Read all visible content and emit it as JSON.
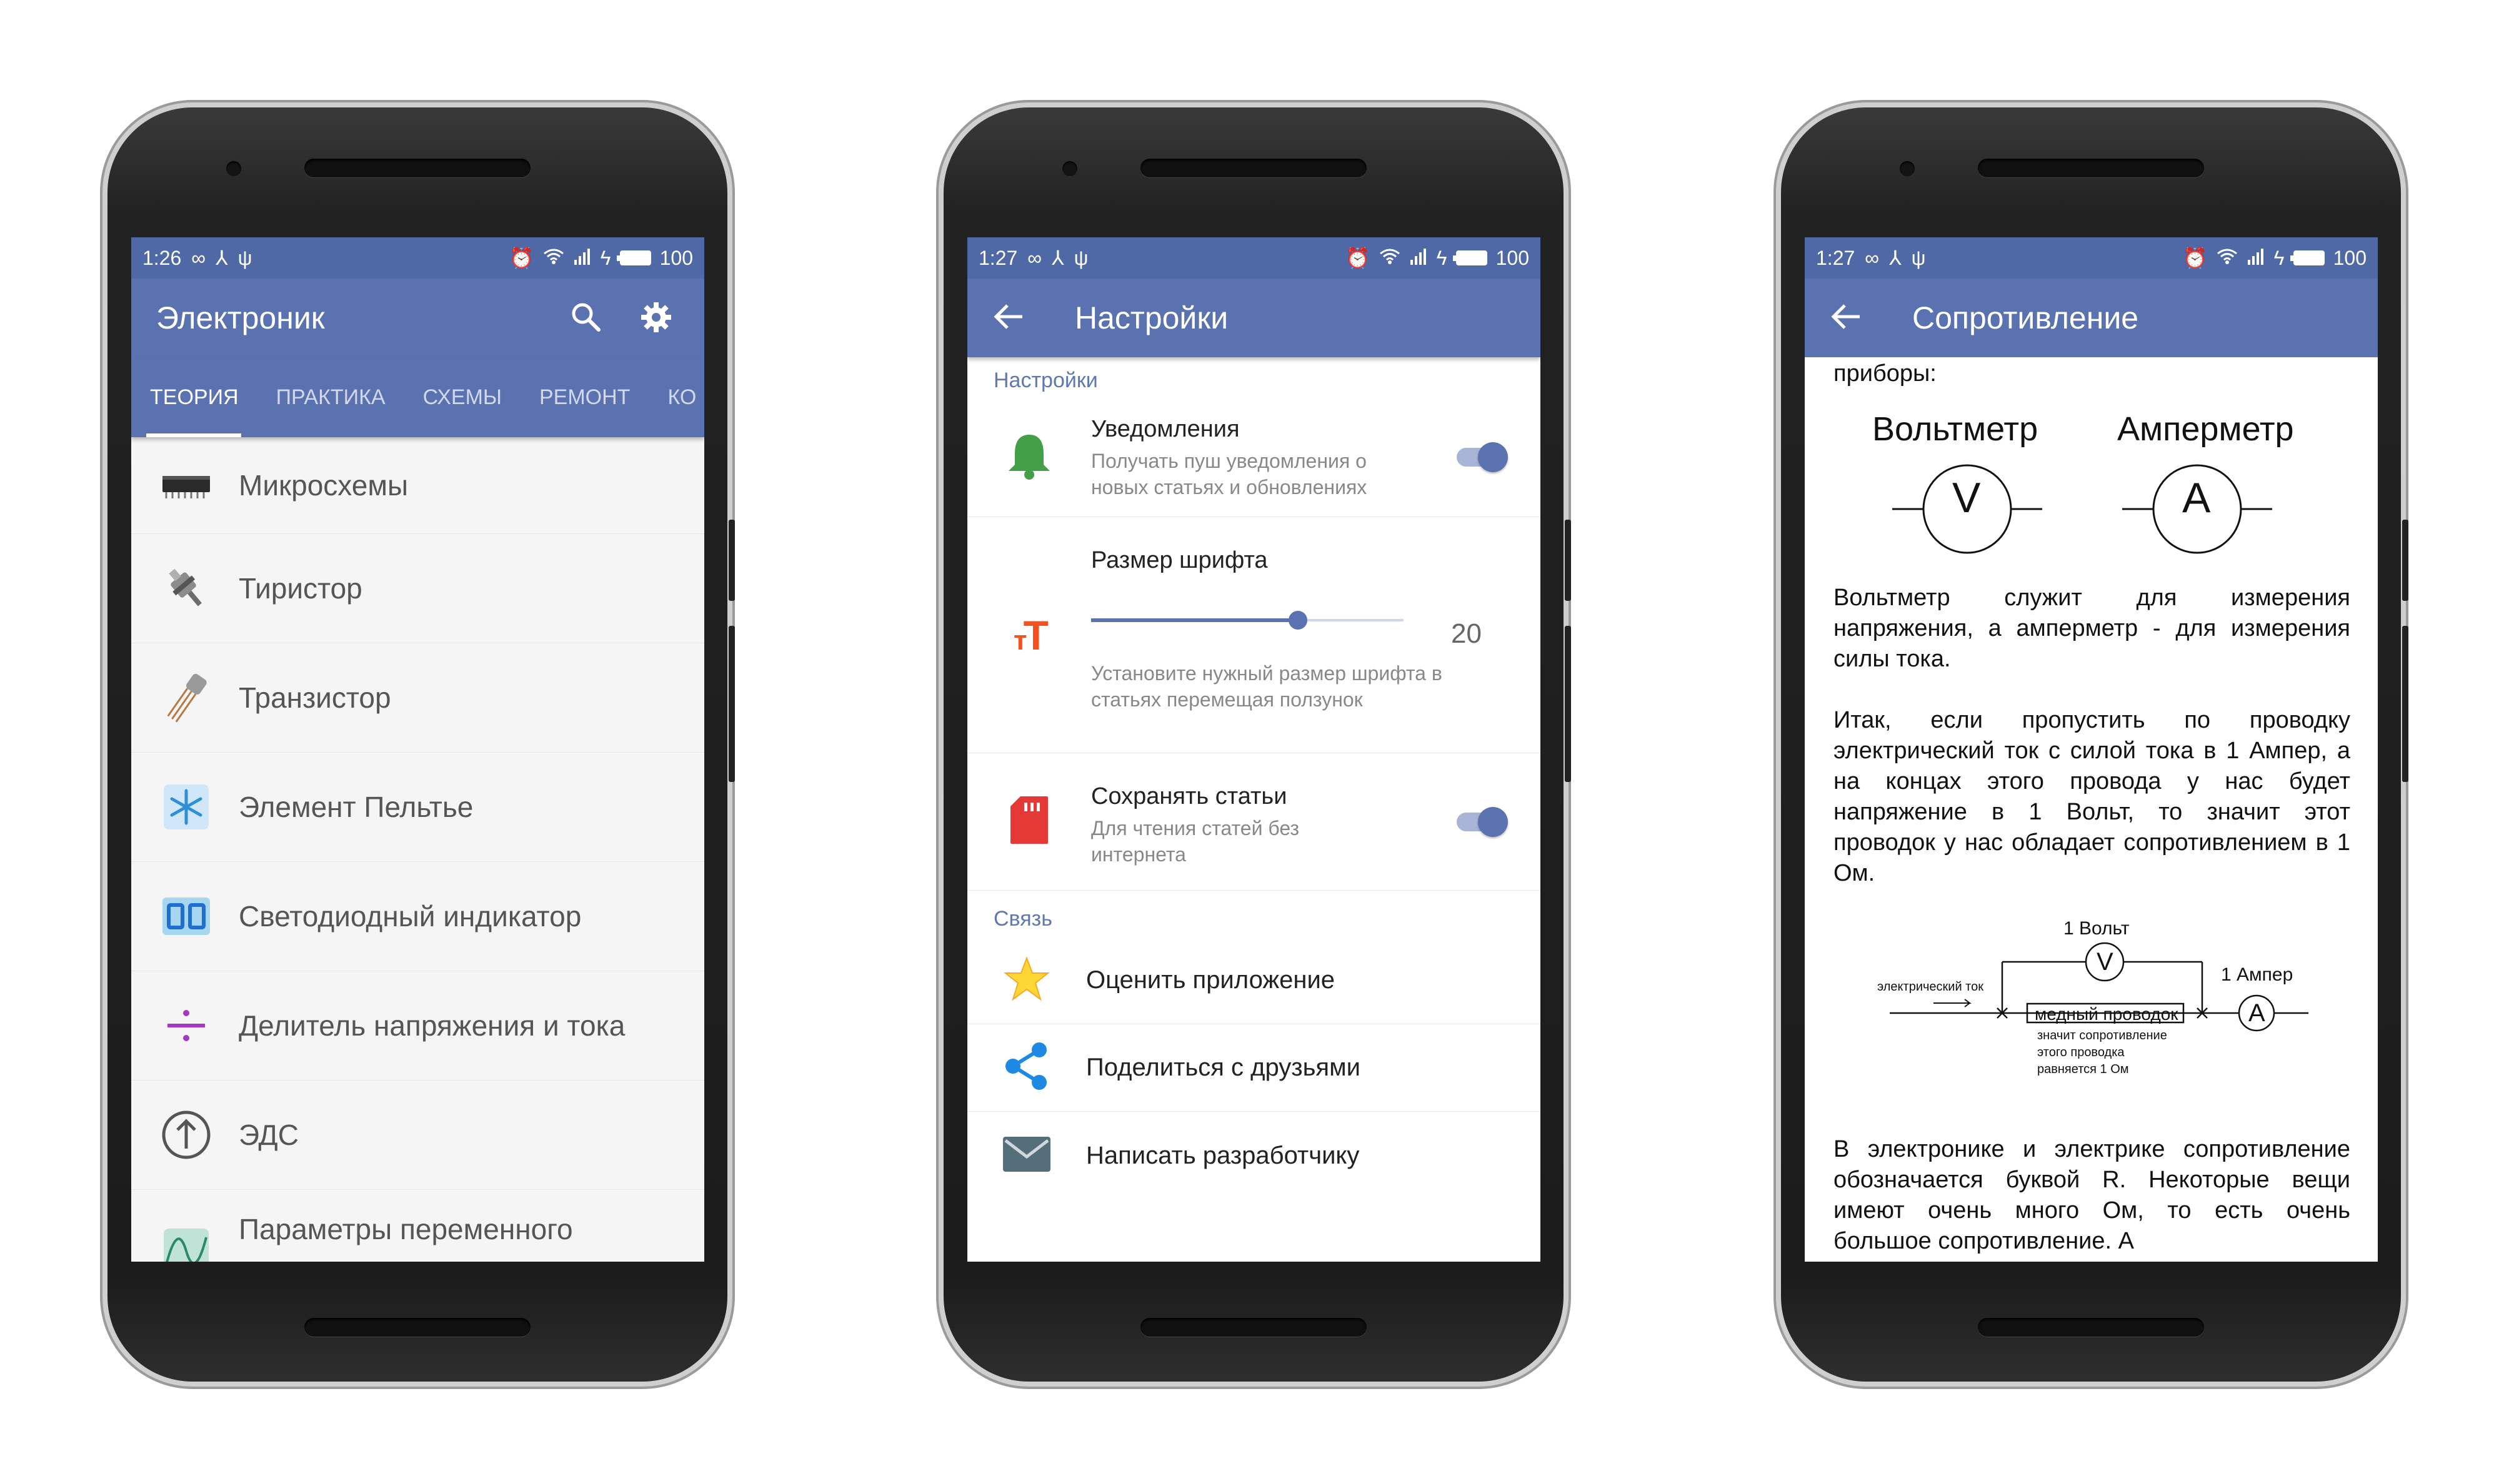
{
  "status": {
    "phone1_time": "1:26",
    "phone2_time": "1:27",
    "phone3_time": "1:27",
    "battery": "100"
  },
  "phone1": {
    "title": "Электроник",
    "tabs": [
      "ТЕОРИЯ",
      "ПРАКТИКА",
      "СХЕМЫ",
      "РЕМОНТ",
      "КО"
    ],
    "items": [
      {
        "label": "Микросхемы",
        "icon": "microchip-icon"
      },
      {
        "label": "Тиристор",
        "icon": "thyristor-icon"
      },
      {
        "label": "Транзистор",
        "icon": "transistor-icon"
      },
      {
        "label": "Элемент Пельтье",
        "icon": "snowflake-icon"
      },
      {
        "label": "Светодиодный индикатор",
        "icon": "led-display-icon"
      },
      {
        "label": "Делитель напряжения и тока",
        "icon": "divide-icon"
      },
      {
        "label": "ЭДС",
        "icon": "arrow-up-circle-icon"
      },
      {
        "label": "Параметры переменного",
        "icon": "sine-wave-icon"
      }
    ]
  },
  "phone2": {
    "title": "Настройки",
    "section_settings": "Настройки",
    "notifications": {
      "title": "Уведомления",
      "sub1": "Получать пуш уведомления о",
      "sub2": "новых статьях и обновлениях",
      "enabled": true
    },
    "font_size": {
      "title": "Размер шрифта",
      "value": "20",
      "sub1": "Установите нужный размер шрифта в",
      "sub2": "статьях перемещая ползунок"
    },
    "save_articles": {
      "title": "Сохранять статьи",
      "sub1": "Для чтения статей без",
      "sub2": "интернета",
      "enabled": true
    },
    "section_contact": "Связь",
    "links": [
      {
        "label": "Оценить приложение",
        "icon": "star-icon"
      },
      {
        "label": "Поделиться с друзьями",
        "icon": "share-icon"
      },
      {
        "label": "Написать разработчику",
        "icon": "mail-icon"
      }
    ]
  },
  "phone3": {
    "title": "Сопротивление",
    "cut_line": "приборы:",
    "voltmeter_label": "Вольтметр",
    "ammeter_label": "Амперметр",
    "voltmeter_symbol": "V",
    "ammeter_symbol": "A",
    "para1": "Вольтметр служит для измерения напряжения, а амперметр - для измерения силы тока.",
    "para2": "Итак, если пропустить по проводку электрический ток с силой тока в 1 Ампер, а на концах этого провода у нас будет напряжение в 1 Вольт, то значит этот проводок у нас обладает сопротивлением в 1 Ом.",
    "diagram": {
      "volt_label": "1 Вольт",
      "amp_label": "1 Ампер",
      "current_label": "электрический ток",
      "wire_label": "медный проводок",
      "note1": "значит сопротивление",
      "note2": "этого проводка",
      "note3": "равняется 1 Ом"
    },
    "para3": "В электронике и электрике сопротивление обозначается буквой R. Некоторые вещи имеют очень много Ом, то есть очень большое сопротивление. А"
  }
}
